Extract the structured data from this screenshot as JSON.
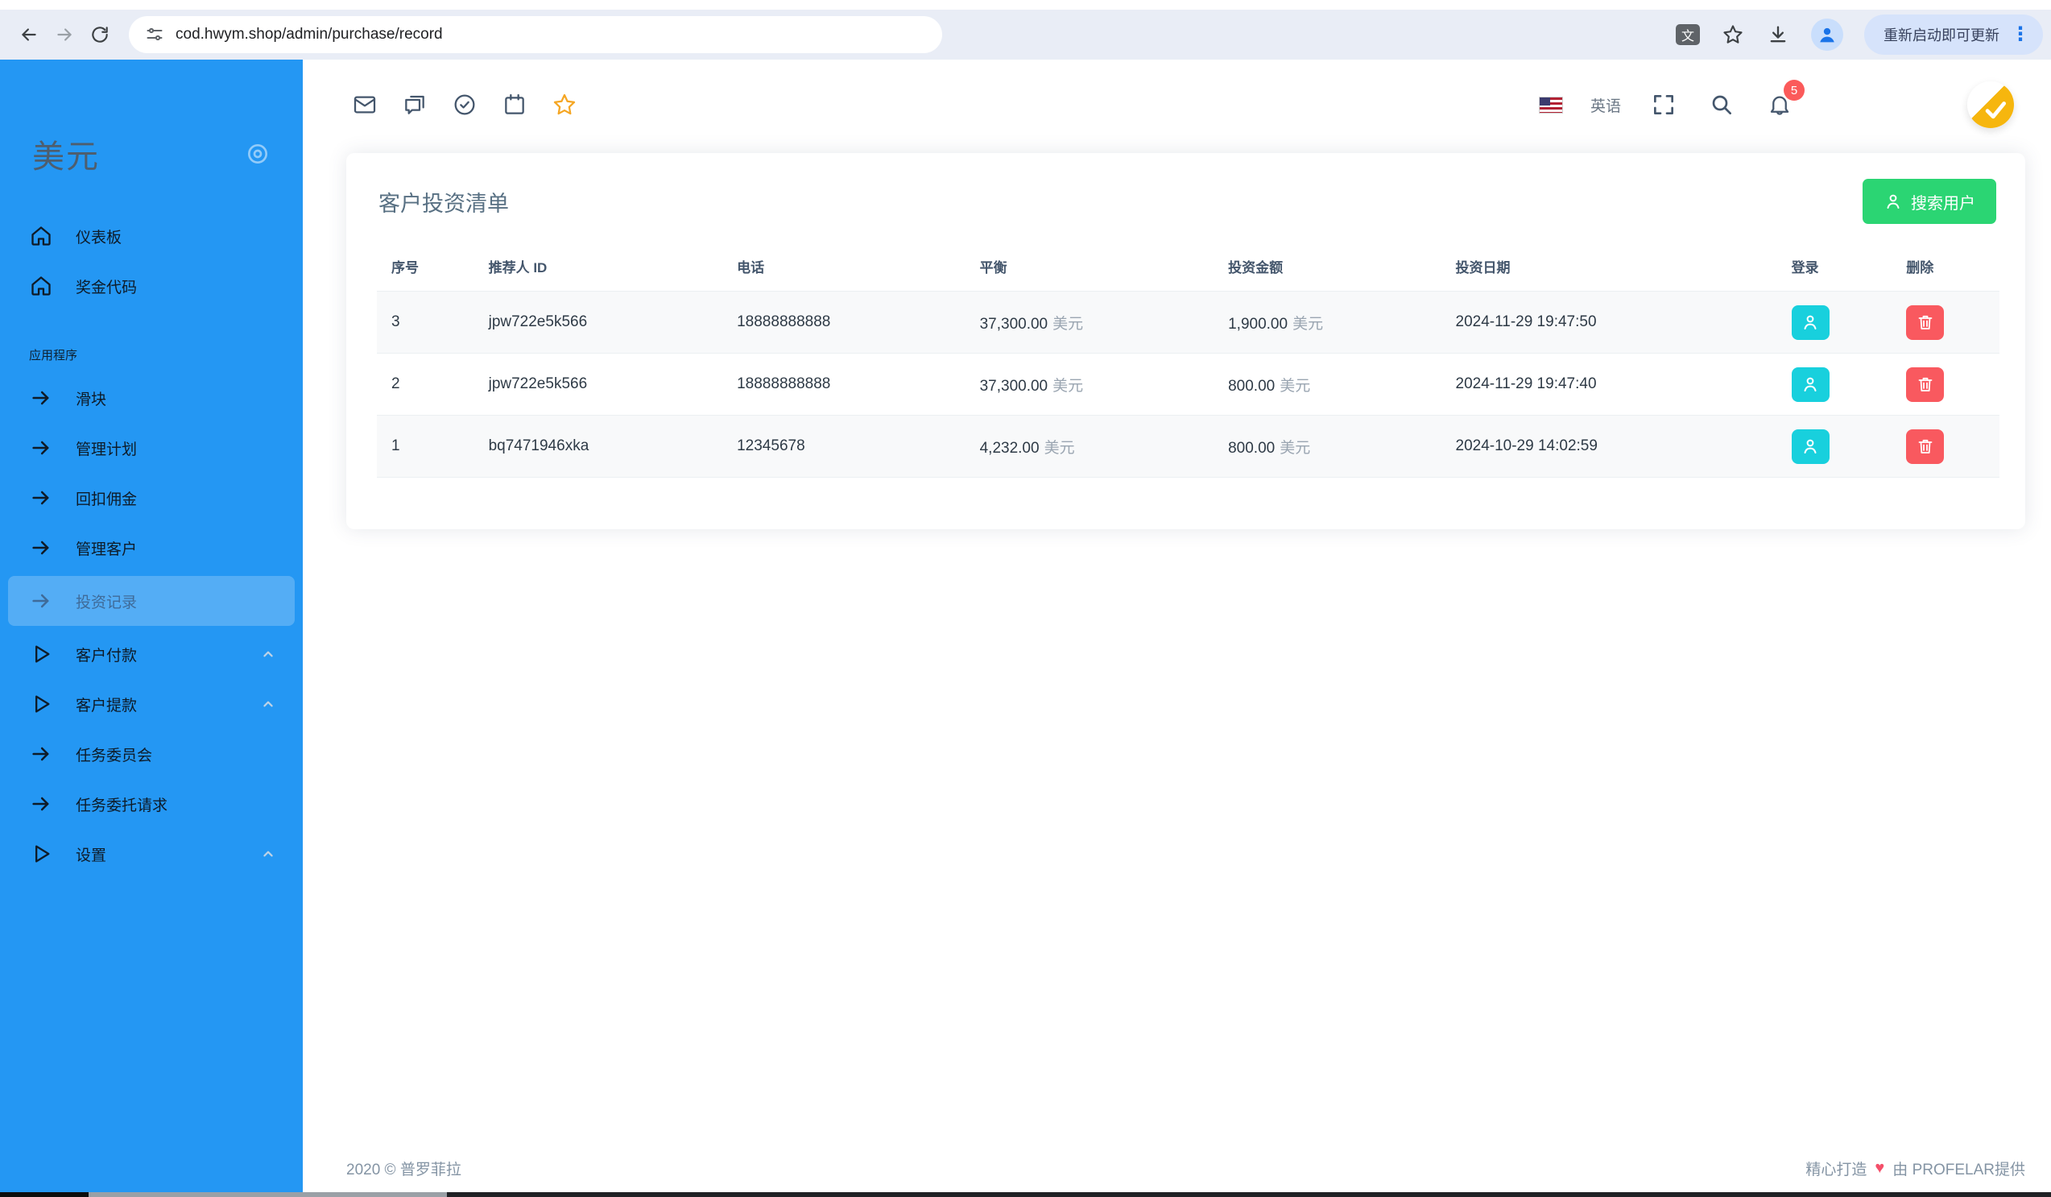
{
  "browser": {
    "url": "cod.hwym.shop/admin/purchase/record",
    "update_button": "重新启动即可更新"
  },
  "sidebar": {
    "logo": "美元",
    "section_label": "应用程序",
    "items": [
      {
        "label": "仪表板",
        "icon": "home"
      },
      {
        "label": "奖金代码",
        "icon": "home"
      },
      {
        "label": "滑块",
        "icon": "arrow"
      },
      {
        "label": "管理计划",
        "icon": "arrow"
      },
      {
        "label": "回扣佣金",
        "icon": "arrow"
      },
      {
        "label": "管理客户",
        "icon": "arrow"
      },
      {
        "label": "投资记录",
        "icon": "arrow",
        "active": true
      },
      {
        "label": "客户付款",
        "icon": "triangle",
        "collapsible": true
      },
      {
        "label": "客户提款",
        "icon": "triangle",
        "collapsible": true
      },
      {
        "label": "任务委员会",
        "icon": "arrow"
      },
      {
        "label": "任务委托请求",
        "icon": "arrow"
      },
      {
        "label": "设置",
        "icon": "triangle",
        "collapsible": true
      }
    ]
  },
  "topbar": {
    "language": "英语",
    "notification_count": "5"
  },
  "card": {
    "title": "客户投资清单",
    "search_button": "搜索用户",
    "currency": "美元",
    "table": {
      "headers": [
        "序号",
        "推荐人 ID",
        "电话",
        "平衡",
        "投资金额",
        "投资日期",
        "登录",
        "删除"
      ],
      "rows": [
        {
          "no": "3",
          "referrer": "jpw722e5k566",
          "phone": "18888888888",
          "balance": "37,300.00",
          "amount": "1,900.00",
          "date": "2024-11-29 19:47:50"
        },
        {
          "no": "2",
          "referrer": "jpw722e5k566",
          "phone": "18888888888",
          "balance": "37,300.00",
          "amount": "800.00",
          "date": "2024-11-29 19:47:40"
        },
        {
          "no": "1",
          "referrer": "bq7471946xka",
          "phone": "12345678",
          "balance": "4,232.00",
          "amount": "800.00",
          "date": "2024-10-29 14:02:59"
        }
      ]
    }
  },
  "footer": {
    "left": "2020 © 普罗菲拉",
    "right_prefix": "精心打造",
    "right_suffix": "由 PROFELAR提供"
  },
  "colors": {
    "sidebar_blue": "#2497f3",
    "button_green": "#2bd573",
    "login_cyan": "#18d0dd",
    "delete_red": "#f9595f",
    "badge_red": "#fb5a5a",
    "avatar_orange": "#f6b60e",
    "heart_red": "#f4506a",
    "title_slate": "#587083"
  }
}
